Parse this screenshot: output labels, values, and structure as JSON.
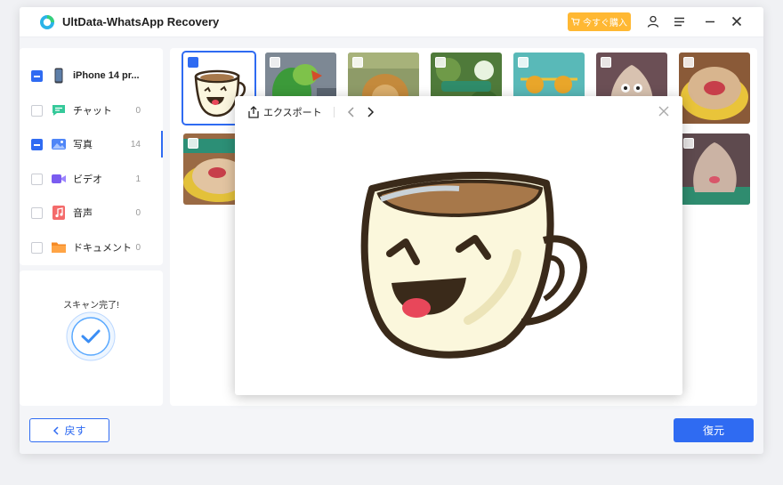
{
  "app": {
    "title": "UltData-WhatsApp Recovery",
    "buy_label": "今すぐ購入"
  },
  "sidebar": {
    "items": [
      {
        "label": "iPhone 14 pr...",
        "count": "",
        "checked": true,
        "icon": "phone-icon"
      },
      {
        "label": "チャット",
        "count": "0",
        "checked": false,
        "icon": "chat-icon"
      },
      {
        "label": "写真",
        "count": "14",
        "checked": true,
        "icon": "photo-icon"
      },
      {
        "label": "ビデオ",
        "count": "1",
        "checked": false,
        "icon": "video-icon"
      },
      {
        "label": "音声",
        "count": "0",
        "checked": false,
        "icon": "audio-icon"
      },
      {
        "label": "ドキュメント",
        "count": "0",
        "checked": false,
        "icon": "folder-icon"
      }
    ],
    "scan_status": "スキャン完了!"
  },
  "preview": {
    "export_label": "エクスポート"
  },
  "footer": {
    "back_label": "戻す",
    "restore_label": "復元"
  },
  "colors": {
    "accent": "#2f6bf2",
    "buy": "#ffb833"
  }
}
